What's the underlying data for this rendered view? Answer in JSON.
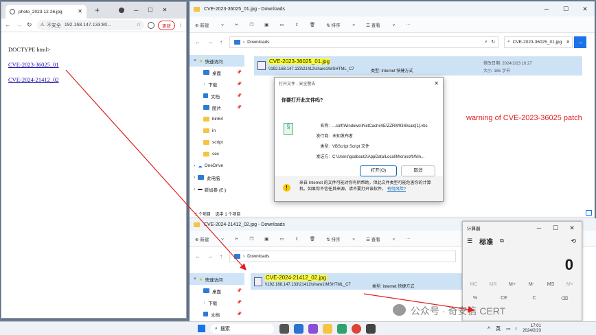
{
  "browser": {
    "tab_title": "photo_2023-12-26.jpg",
    "new_tab": "+",
    "security_label": "不安全",
    "url": "192.168.147.133:80...",
    "update_button": "更新",
    "content": {
      "doctype": "DOCTYPE html>",
      "link1": "CVE-2023-36025_01",
      "link2": "CVE-2024-21412_02"
    }
  },
  "explorer1": {
    "title": "CVE-2023-36025_01.jpg - Downloads",
    "toolbar": {
      "new": "新建",
      "sort": "排序",
      "view": "查看",
      "more": "···"
    },
    "breadcrumb": "Downloads",
    "search": "CVE-2023-36025_01.jpg",
    "sidebar": [
      "快速访问",
      "桌面",
      "下载",
      "文档",
      "图片",
      "bin64",
      "in",
      "script",
      "sec",
      "OneDrive",
      "此电脑",
      "新加卷 (E:)"
    ],
    "file": {
      "name": "CVE-2023-36025_01.jpg",
      "path": "\\\\192.168.147.133\\21412\\share1\\MSHTML_C7",
      "type": "类型: Internet 快捷方式",
      "modified": "修改日期: 2024/2/23 16:27",
      "size": "大小: 165 字节"
    },
    "status": "1 个项目    选中 1 个项目"
  },
  "dialog": {
    "title": "打开文件 - 安全警告",
    "question": "你要打开此文件吗?",
    "name_label": "名称:",
    "name_value": "...soft\\Windows\\INetCache\\IE\\ZZRW93I6\\calc[1].vbs",
    "publisher_label": "发行商:",
    "publisher_value": "未知发布者",
    "type_label": "类型:",
    "type_value": "VBScript Script 文件",
    "from_label": "发送方:",
    "from_value": "C:\\Users\\goabout2\\AppData\\Local\\Microsoft\\Win...",
    "open_button": "打开(O)",
    "cancel_button": "取消",
    "warning_text": "来自 Internet 的文件可能对你有所帮助，但此文件类型可能危害你的计算机。如果你不信任其来源，请不要打开该软件。",
    "warning_link": "有何风险?"
  },
  "annotation": "warning of CVE-2023-36025 patch",
  "explorer2": {
    "title": "CVE-2024-21412_02.jpg - Downloads",
    "toolbar": {
      "new": "新建",
      "sort": "排序",
      "view": "查看",
      "more": "···"
    },
    "breadcrumb": "Downloads",
    "sidebar": [
      "快速访问",
      "桌面",
      "下载",
      "文档"
    ],
    "file": {
      "name": "CVE-2024-21412_02.jpg",
      "path": "\\\\192.168.147.133\\21412\\share1\\MSHTML_C7",
      "type": "类型: Internet 快捷方式"
    }
  },
  "calculator": {
    "title": "计算器",
    "mode": "标准",
    "display": "0",
    "mem": [
      "MC",
      "MR",
      "M+",
      "M-",
      "MS",
      "M˅"
    ],
    "keys": [
      "%",
      "CE",
      "C",
      "⌫"
    ]
  },
  "taskbar": {
    "search": "搜索",
    "lang": "英",
    "time": "17:01",
    "date": "2024/2/23"
  },
  "watermark": "公众号 · 奇安信 CERT"
}
